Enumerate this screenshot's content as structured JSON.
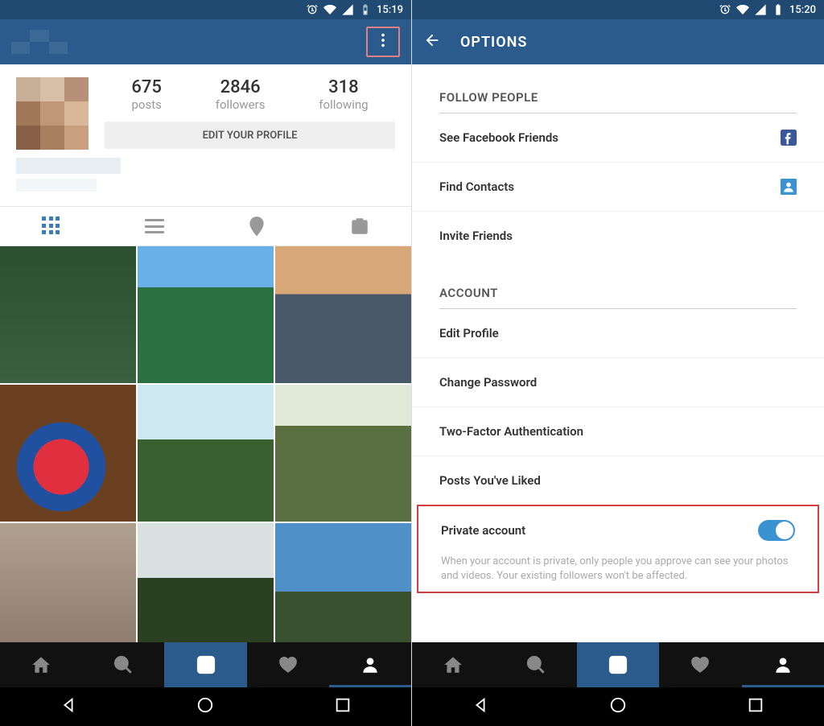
{
  "left": {
    "status_time": "15:19",
    "stats": {
      "posts_num": "675",
      "posts_lbl": "posts",
      "followers_num": "2846",
      "followers_lbl": "followers",
      "following_num": "318",
      "following_lbl": "following"
    },
    "edit_profile_label": "EDIT YOUR PROFILE"
  },
  "right": {
    "status_time": "15:20",
    "header_title": "OPTIONS",
    "sections": {
      "follow_title": "FOLLOW PEOPLE",
      "see_fb": "See Facebook Friends",
      "find_contacts": "Find Contacts",
      "invite": "Invite Friends",
      "account_title": "ACCOUNT",
      "edit_profile": "Edit Profile",
      "change_pw": "Change Password",
      "two_factor": "Two-Factor Authentication",
      "posts_liked": "Posts You've Liked",
      "private": "Private account",
      "private_desc": "When your account is private, only people you approve can see your photos and videos. Your existing followers won't be affected."
    }
  }
}
